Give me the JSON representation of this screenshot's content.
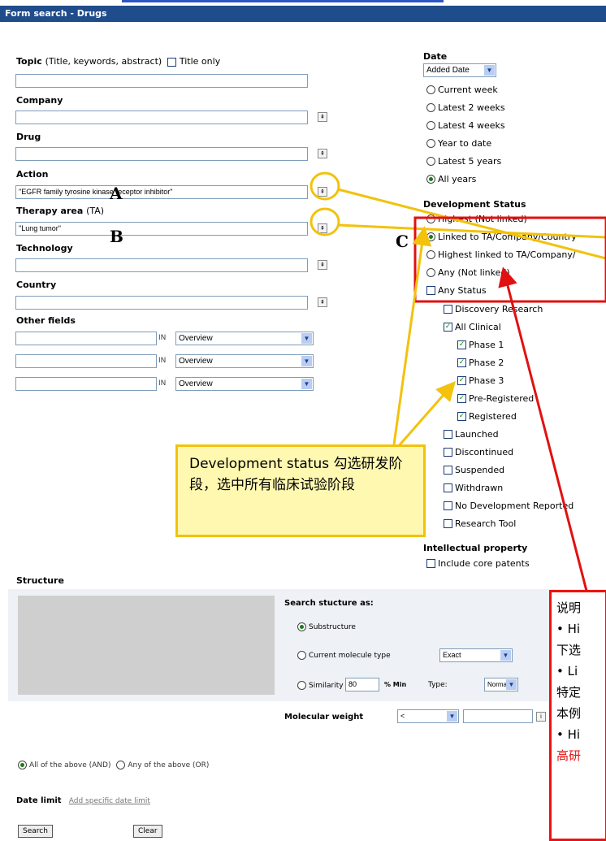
{
  "window": {
    "title": "Form search - Drugs"
  },
  "topic": {
    "label": "Topic",
    "hint": "(Title, keywords, abstract)",
    "title_only_label": "Title only",
    "value": ""
  },
  "company": {
    "label": "Company",
    "value": ""
  },
  "drug": {
    "label": "Drug",
    "value": ""
  },
  "action": {
    "label": "Action",
    "value": "\"EGFR family tyrosine kinase receptor inhibitor\""
  },
  "therapy": {
    "label": "Therapy area",
    "hint": "(TA)",
    "value": "\"Lung tumor\""
  },
  "technology": {
    "label": "Technology",
    "value": ""
  },
  "country": {
    "label": "Country",
    "value": ""
  },
  "other_fields": {
    "label": "Other fields",
    "in_label": "IN",
    "rows": [
      {
        "value": "",
        "select": "Overview"
      },
      {
        "value": "",
        "select": "Overview"
      },
      {
        "value": "",
        "select": "Overview"
      }
    ]
  },
  "date": {
    "label": "Date",
    "select": "Added Date",
    "options": [
      {
        "label": "Current week",
        "selected": false
      },
      {
        "label": "Latest 2 weeks",
        "selected": false
      },
      {
        "label": "Latest 4 weeks",
        "selected": false
      },
      {
        "label": "Year to date",
        "selected": false
      },
      {
        "label": "Latest 5 years",
        "selected": false
      },
      {
        "label": "All years",
        "selected": true
      }
    ]
  },
  "dev_status": {
    "label": "Development Status",
    "options": [
      {
        "label": "Highest (Not linked)",
        "selected": false
      },
      {
        "label": "Linked to TA/Company/Country",
        "selected": true
      },
      {
        "label": "Highest linked to TA/Company/",
        "selected": false
      },
      {
        "label": "Any (Not linked)",
        "selected": false
      }
    ],
    "any_status": {
      "label": "Any Status",
      "checked": false
    },
    "phases": [
      {
        "label": "Discovery Research",
        "checked": false,
        "level": 1
      },
      {
        "label": "All Clinical",
        "checked": true,
        "level": 1
      },
      {
        "label": "Phase 1",
        "checked": true,
        "level": 2
      },
      {
        "label": "Phase 2",
        "checked": true,
        "level": 2
      },
      {
        "label": "Phase 3",
        "checked": true,
        "level": 2
      },
      {
        "label": "Pre-Registered",
        "checked": true,
        "level": 2
      },
      {
        "label": "Registered",
        "checked": true,
        "level": 2
      },
      {
        "label": "Launched",
        "checked": false,
        "level": 1
      },
      {
        "label": "Discontinued",
        "checked": false,
        "level": 1
      },
      {
        "label": "Suspended",
        "checked": false,
        "level": 1
      },
      {
        "label": "Withdrawn",
        "checked": false,
        "level": 1
      },
      {
        "label": "No Development Reported",
        "checked": false,
        "level": 1
      },
      {
        "label": "Research Tool",
        "checked": false,
        "level": 1
      }
    ]
  },
  "ip": {
    "label": "Intellectual property",
    "core_patents_label": "Include core patents"
  },
  "structure": {
    "label": "Structure",
    "search_as": "Search stucture as:",
    "substructure": "Substructure",
    "current_type": "Current molecule type",
    "current_type_select": "Exact",
    "similarity": "Similarity",
    "similarity_value": "80",
    "pct_min": "% Min",
    "type_label": "Type:",
    "type_select": "Normal",
    "mw_label": "Molecular weight",
    "mw_select": "<",
    "mw_value": ""
  },
  "combine": {
    "and_label": "All of the above (AND)",
    "or_label": "Any of the above (OR)"
  },
  "date_limit": {
    "label": "Date limit",
    "link": "Add specific date limit"
  },
  "buttons": {
    "search": "Search",
    "clear": "Clear"
  },
  "annotations": {
    "a": "A",
    "b": "B",
    "c": "C",
    "yellow_note": "Development status 勾选研发阶段，选中所有临床试验阶段",
    "red_lines": [
      "说明",
      "• Hi",
      "下选",
      "• Li",
      "特定",
      "本例",
      "• Hi",
      "高研"
    ]
  },
  "colors": {
    "titlebar": "#1f4c8a",
    "annotation_yellow": "#f2c20c",
    "annotation_red": "#e11111"
  }
}
